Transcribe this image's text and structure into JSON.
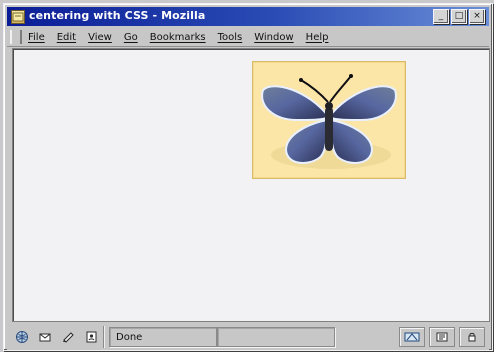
{
  "window": {
    "title": "centering with CSS - Mozilla",
    "controls": {
      "minimize_label": "_",
      "maximize_label": "□",
      "close_label": "×"
    }
  },
  "menubar": {
    "items": [
      {
        "label": "File"
      },
      {
        "label": "Edit"
      },
      {
        "label": "View"
      },
      {
        "label": "Go"
      },
      {
        "label": "Bookmarks"
      },
      {
        "label": "Tools"
      },
      {
        "label": "Window"
      },
      {
        "label": "Help"
      }
    ]
  },
  "content": {
    "image": {
      "icon": "butterfly-image",
      "background_color": "#fbe6a7",
      "border_color": "#d7bb66"
    }
  },
  "statusbar": {
    "status_text": "Done",
    "left_icons": [
      "globe-icon",
      "mail-icon",
      "composer-icon",
      "address-book-icon"
    ],
    "right_icons": [
      "security-icon",
      "online-status-icon",
      "lock-icon"
    ]
  }
}
